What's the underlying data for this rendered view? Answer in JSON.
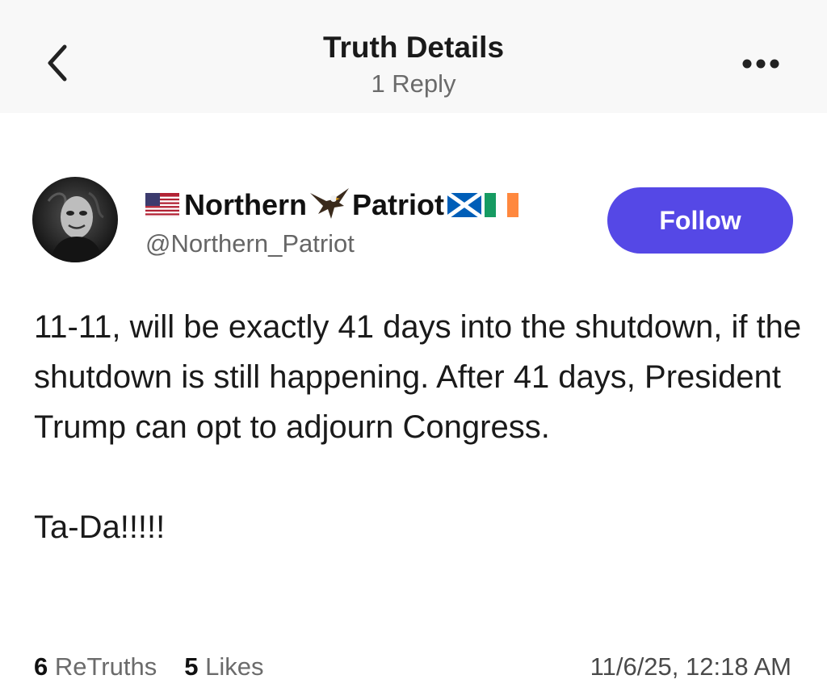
{
  "header": {
    "title": "Truth Details",
    "subtitle": "1 Reply",
    "back_icon": "chevron-left-icon",
    "more_icon": "more-horizontal-icon"
  },
  "author": {
    "name_prefix_flag": "us-flag",
    "name_first": "Northern",
    "name_emoji": "eagle",
    "name_second": "Patriot",
    "name_suffix_flags": [
      "scotland-flag",
      "ireland-flag"
    ],
    "handle": "@Northern_Patriot",
    "avatar": "masked-figure-avatar"
  },
  "follow_button": {
    "label": "Follow",
    "color": "#5548e6"
  },
  "post": {
    "line1": "11-11, will be exactly 41 days into the shutdown, if the shutdown is still happening. After 41 days, President Trump can opt to adjourn Congress.",
    "line2": "Ta-Da!!!!!"
  },
  "stats": {
    "retruths_count": "6",
    "retruths_label": "ReTruths",
    "likes_count": "5",
    "likes_label": "Likes",
    "timestamp": "11/6/25, 12:18 AM"
  }
}
